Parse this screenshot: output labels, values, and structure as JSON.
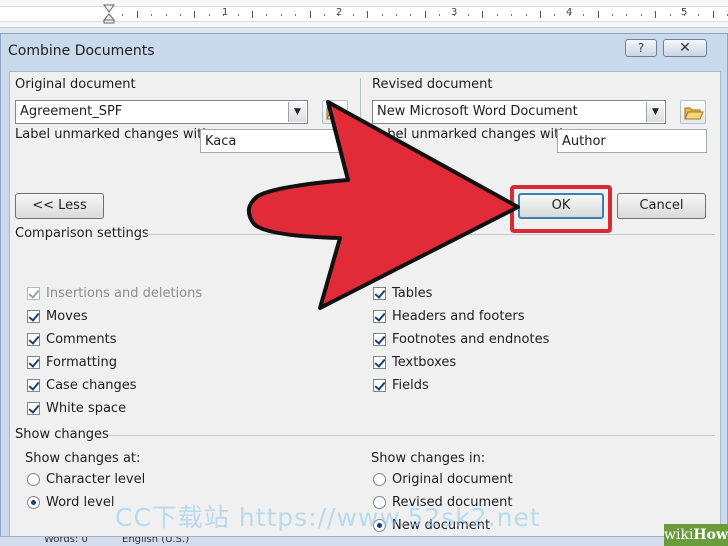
{
  "ruler": {
    "numbers": [
      "1",
      "2",
      "3",
      "4",
      "5"
    ]
  },
  "dialog": {
    "title": "Combine Documents",
    "help_label": "?",
    "close_label": "✕"
  },
  "original": {
    "header": "Original document",
    "selected": "Agreement_SPF",
    "label_text": "Label unmarked changes with:",
    "label_value": "Kaca"
  },
  "revised": {
    "header": "Revised document",
    "selected": "New Microsoft Word Document",
    "label_text": "Label unmarked changes with:",
    "label_value": "Author"
  },
  "buttons": {
    "less": "<< Less",
    "ok": "OK",
    "cancel": "Cancel"
  },
  "comparison": {
    "title": "Comparison settings",
    "left": [
      {
        "label": "Insertions and deletions",
        "checked": true,
        "disabled": true
      },
      {
        "label": "Moves",
        "checked": true
      },
      {
        "label": "Comments",
        "checked": true
      },
      {
        "label": "Formatting",
        "checked": true
      },
      {
        "label": "Case changes",
        "checked": true
      },
      {
        "label": "White space",
        "checked": true
      }
    ],
    "right": [
      {
        "label": "Tables",
        "checked": true
      },
      {
        "label": "Headers and footers",
        "checked": true
      },
      {
        "label": "Footnotes and endnotes",
        "checked": true
      },
      {
        "label": "Textboxes",
        "checked": true
      },
      {
        "label": "Fields",
        "checked": true
      }
    ]
  },
  "show_changes": {
    "title": "Show changes",
    "at_label": "Show changes at:",
    "at_options": [
      {
        "label": "Character level",
        "selected": false
      },
      {
        "label": "Word level",
        "selected": true
      }
    ],
    "in_label": "Show changes in:",
    "in_options": [
      {
        "label": "Original document",
        "selected": false
      },
      {
        "label": "Revised document",
        "selected": false
      },
      {
        "label": "New document",
        "selected": true
      }
    ]
  },
  "watermark": "CC下载站 https://www.52sk2.net",
  "statusbar": {
    "words": "Words: 0",
    "language": "English (U.S.)"
  },
  "branding": {
    "wiki": "wiki",
    "how": "How"
  },
  "colors": {
    "arrow": "#e12b38",
    "highlight": "#d92b35",
    "accent": "#3c7fb1"
  }
}
